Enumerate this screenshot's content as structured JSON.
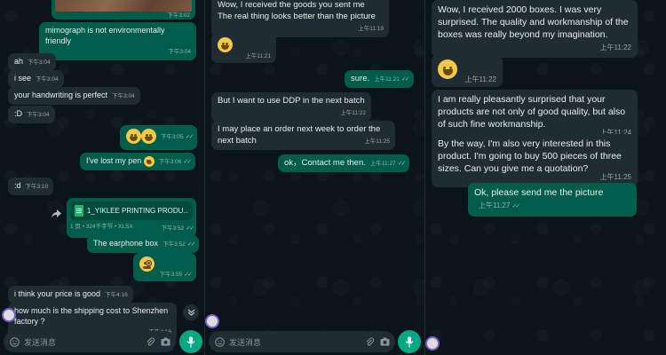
{
  "input_placeholder": "发送消息",
  "colors": {
    "incoming": "#202c33",
    "outgoing": "#005c4b",
    "accent": "#00a884",
    "background": "#0b141a"
  },
  "icons": [
    "emoji-icon",
    "attach-icon",
    "camera-icon",
    "mic-icon",
    "forward-icon",
    "chevron-down-icon",
    "double-check-icon"
  ],
  "panel1": {
    "photo_time": "下午3:02",
    "messages": [
      {
        "text": "mimograph is not environmentally friendly",
        "time": "下午3:04"
      },
      {
        "text": "ah",
        "time": "下午3:04"
      },
      {
        "text": "i see",
        "time": "下午3:04"
      },
      {
        "text": "your handwriting is perfect",
        "time": "下午3:04"
      },
      {
        "text": ":D",
        "time": "下午3:04"
      },
      {
        "text": "",
        "time": "下午3:05"
      },
      {
        "text": "I've lost my pen",
        "time": "下午3:06"
      },
      {
        "text": ":d",
        "time": "下午3:10"
      },
      {
        "file_name": "1_YIKLEE PRINTING PRODU...",
        "file_meta": "1 页 • 324千字节 • XLSX",
        "time": "下午3:52"
      },
      {
        "text": "The earphone box",
        "time": "下午3:52"
      },
      {
        "text": "",
        "time": "下午3:55"
      },
      {
        "text": "i think your price is good",
        "time": "下午4:16"
      },
      {
        "text": "how much is the shipping cost to Shenzhen factory ?",
        "time": "下午4:16"
      }
    ]
  },
  "panel2": {
    "messages": [
      {
        "text": "Wow, I received the goods you sent me\nThe real thing looks better than the picture",
        "time": "上午11:19"
      },
      {
        "text": "",
        "time": "上午11:21"
      },
      {
        "text": "sure.",
        "time": "上午11:21"
      },
      {
        "text": "But I want to use DDP in the next batch",
        "time": "上午11:22"
      },
      {
        "text": "I may place an order next week to order the next batch",
        "time": "上午11:25"
      },
      {
        "text": "ok，Contact me then.",
        "time": "上午11:27"
      }
    ]
  },
  "panel3": {
    "messages": [
      {
        "text": "Wow, I received 2000 boxes. I was very surprised. The quality and workmanship of the boxes was really beyond my imagination.",
        "time": "上午11:22"
      },
      {
        "text": "",
        "time": "上午11:22"
      },
      {
        "text": "I am really pleasantly surprised that your products are not only of good quality, but also of such fine workmanship.",
        "time": "上午11:24"
      },
      {
        "text": "By the way, I'm also very interested in this product. I'm going to buy 500 pieces of three sizes. Can you give me a quotation?",
        "time": "上午11:25"
      },
      {
        "text": "Ok, please send me the picture",
        "time": "上午11:27"
      }
    ]
  }
}
